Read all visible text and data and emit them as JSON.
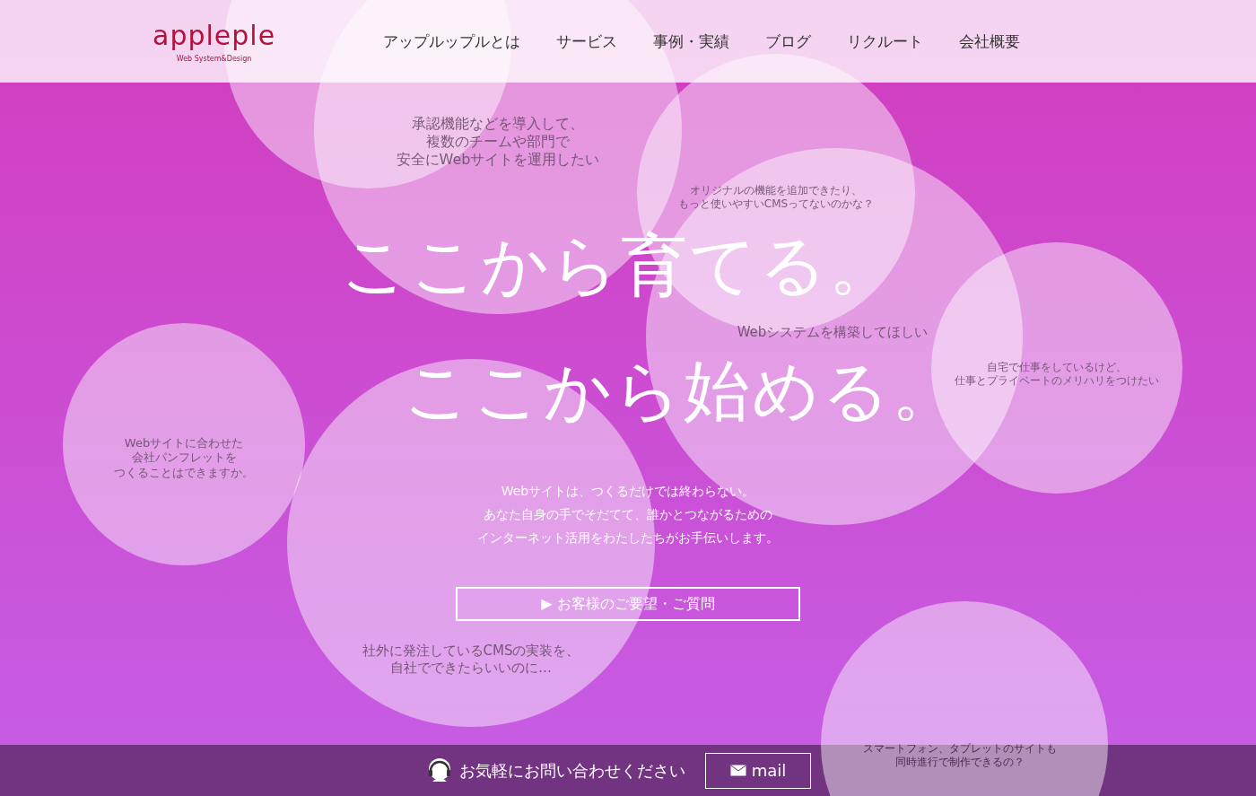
{
  "header": {
    "logo": "appleple",
    "tagline": "Web System&Design",
    "nav": [
      {
        "label": "アップルップルとは"
      },
      {
        "label": "サービス"
      },
      {
        "label": "事例・実績"
      },
      {
        "label": "ブログ"
      },
      {
        "label": "リクルート"
      },
      {
        "label": "会社概要"
      }
    ]
  },
  "hero": {
    "title_lines": [
      "ここから育てる。",
      "ここから始める。"
    ],
    "lead": [
      "Webサイトは、つくるだけでは終わらない。",
      "あなた自身の手でそだてて、誰かとつながるための",
      "インターネット活用をわたしたちがお手伝いします。"
    ],
    "button": {
      "icon": "▶",
      "label": "お客様のご要望・ご質問"
    }
  },
  "bubbles": [
    {
      "lines": [
        "承認機能などを導入して、",
        "複数のチームや部門で",
        "安全にWebサイトを運用したい"
      ]
    },
    {
      "lines": [
        "オリジナルの機能を追加できたり、",
        "もっと使いやすいCMSってないのかな？"
      ]
    },
    {
      "lines": [
        "Webシステムを構築してほしい"
      ]
    },
    {
      "lines": [
        "自宅で仕事をしているけど、",
        "仕事とプライベートのメリハリをつけたい"
      ]
    },
    {
      "lines": [
        "Webサイトに合わせた",
        "会社パンフレットを",
        "つくることはできますか。"
      ]
    },
    {
      "lines": [
        "社外に発注しているCMSの実装を、",
        "自社でできたらいいのに…"
      ]
    },
    {
      "lines": [
        "スマートフォン、タブレットのサイトも",
        "同時進行で制作できるの？"
      ]
    }
  ],
  "footer": {
    "contact": "お気軽にお問い合わせください",
    "mail_button": "mail"
  }
}
